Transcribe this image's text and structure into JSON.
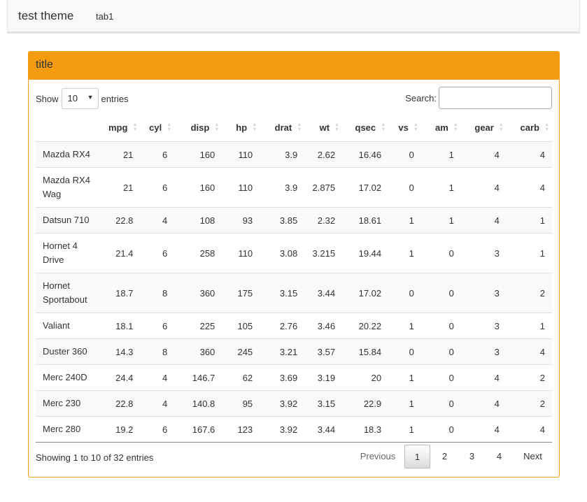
{
  "navbar": {
    "brand": "test theme",
    "tabs": [
      {
        "label": "tab1"
      }
    ]
  },
  "panel": {
    "title": "title",
    "accent_color": "#f39c12"
  },
  "controls": {
    "show_label": "Show",
    "entries_label": "entries",
    "page_length": "10",
    "search_label": "Search:",
    "search_value": ""
  },
  "table": {
    "columns": [
      "",
      "mpg",
      "cyl",
      "disp",
      "hp",
      "drat",
      "wt",
      "qsec",
      "vs",
      "am",
      "gear",
      "carb"
    ],
    "rows": [
      [
        "Mazda RX4",
        "21",
        "6",
        "160",
        "110",
        "3.9",
        "2.62",
        "16.46",
        "0",
        "1",
        "4",
        "4"
      ],
      [
        "Mazda RX4 Wag",
        "21",
        "6",
        "160",
        "110",
        "3.9",
        "2.875",
        "17.02",
        "0",
        "1",
        "4",
        "4"
      ],
      [
        "Datsun 710",
        "22.8",
        "4",
        "108",
        "93",
        "3.85",
        "2.32",
        "18.61",
        "1",
        "1",
        "4",
        "1"
      ],
      [
        "Hornet 4 Drive",
        "21.4",
        "6",
        "258",
        "110",
        "3.08",
        "3.215",
        "19.44",
        "1",
        "0",
        "3",
        "1"
      ],
      [
        "Hornet Sportabout",
        "18.7",
        "8",
        "360",
        "175",
        "3.15",
        "3.44",
        "17.02",
        "0",
        "0",
        "3",
        "2"
      ],
      [
        "Valiant",
        "18.1",
        "6",
        "225",
        "105",
        "2.76",
        "3.46",
        "20.22",
        "1",
        "0",
        "3",
        "1"
      ],
      [
        "Duster 360",
        "14.3",
        "8",
        "360",
        "245",
        "3.21",
        "3.57",
        "15.84",
        "0",
        "0",
        "3",
        "4"
      ],
      [
        "Merc 240D",
        "24.4",
        "4",
        "146.7",
        "62",
        "3.69",
        "3.19",
        "20",
        "1",
        "0",
        "4",
        "2"
      ],
      [
        "Merc 230",
        "22.8",
        "4",
        "140.8",
        "95",
        "3.92",
        "3.15",
        "22.9",
        "1",
        "0",
        "4",
        "2"
      ],
      [
        "Merc 280",
        "19.2",
        "6",
        "167.6",
        "123",
        "3.92",
        "3.44",
        "18.3",
        "1",
        "0",
        "4",
        "4"
      ]
    ]
  },
  "footer": {
    "info": "Showing 1 to 10 of 32 entries",
    "previous": "Previous",
    "pages": [
      "1",
      "2",
      "3",
      "4"
    ],
    "current_page": "1",
    "next": "Next"
  }
}
